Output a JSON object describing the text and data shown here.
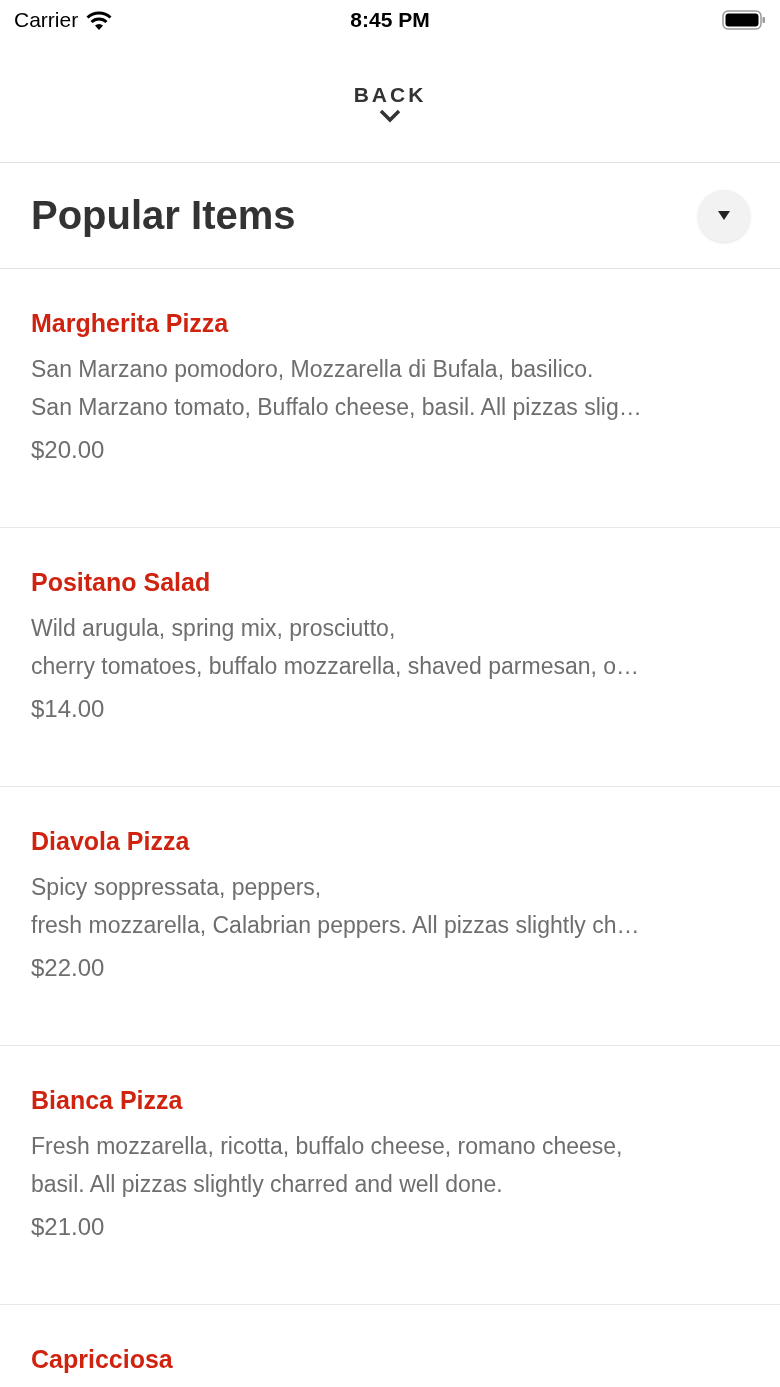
{
  "status_bar": {
    "carrier": "Carrier",
    "time": "8:45 PM"
  },
  "nav": {
    "back_label": "BACK"
  },
  "section": {
    "title": "Popular Items",
    "expanded": true
  },
  "items": [
    {
      "name": "Margherita Pizza",
      "description_lines": [
        "San Marzano pomodoro, Mozzarella di Bufala, basilico.",
        "San Marzano tomato, Buffalo cheese, basil. All pizzas slig…"
      ],
      "price": "$20.00"
    },
    {
      "name": "Positano Salad",
      "description_lines": [
        "Wild arugula, spring mix, prosciutto,",
        "cherry tomatoes, buffalo mozzarella, shaved parmesan, o…"
      ],
      "price": "$14.00"
    },
    {
      "name": "Diavola Pizza",
      "description_lines": [
        "Spicy soppressata, peppers,",
        "fresh mozzarella, Calabrian peppers. All pizzas slightly ch…"
      ],
      "price": "$22.00"
    },
    {
      "name": "Bianca Pizza",
      "description_lines": [
        "Fresh mozzarella, ricotta, buffalo cheese, romano cheese,",
        "basil. All pizzas slightly charred and well done."
      ],
      "price": "$21.00"
    },
    {
      "name": "Capricciosa"
    }
  ]
}
